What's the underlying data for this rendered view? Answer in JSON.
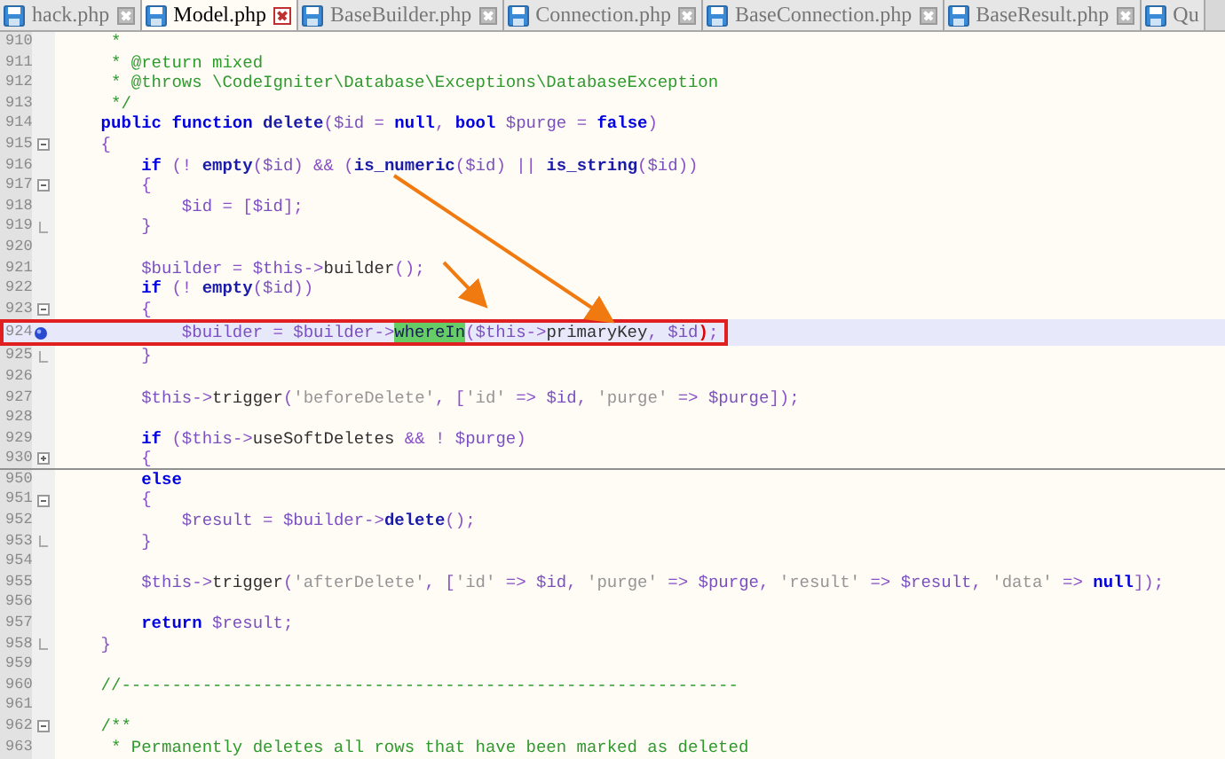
{
  "tabs": [
    {
      "label": "hack.php",
      "selected": false
    },
    {
      "label": "Model.php",
      "selected": true
    },
    {
      "label": "BaseBuilder.php",
      "selected": false
    },
    {
      "label": "Connection.php",
      "selected": false
    },
    {
      "label": "BaseConnection.php",
      "selected": false
    },
    {
      "label": "BaseResult.php",
      "selected": false
    },
    {
      "label": "Qu",
      "selected": false
    }
  ],
  "lines": [
    {
      "number": "910",
      "segments": [
        {
          "t": "     *",
          "kind": "cmt"
        }
      ]
    },
    {
      "number": "911",
      "segments": [
        {
          "t": "     * @return mixed",
          "kind": "cmt"
        }
      ]
    },
    {
      "number": "912",
      "segments": [
        {
          "t": "     * @throws \\CodeIgniter\\Database\\Exceptions\\DatabaseException",
          "kind": "cmt"
        }
      ]
    },
    {
      "number": "913",
      "segments": [
        {
          "t": "     */",
          "kind": "cmt"
        }
      ]
    },
    {
      "number": "914",
      "segments": [
        {
          "t": "    public function ",
          "kind": "kw"
        },
        {
          "t": "delete",
          "kind": "fn"
        },
        {
          "t": "(",
          "kind": "op"
        },
        {
          "t": "$id",
          "kind": "var"
        },
        {
          "t": " = ",
          "kind": "op"
        },
        {
          "t": "null",
          "kind": "kw"
        },
        {
          "t": ", ",
          "kind": "op"
        },
        {
          "t": "bool ",
          "kind": "kw"
        },
        {
          "t": "$purge",
          "kind": "var"
        },
        {
          "t": " = ",
          "kind": "op"
        },
        {
          "t": "false",
          "kind": "kw"
        },
        {
          "t": ")",
          "kind": "op"
        }
      ]
    },
    {
      "number": "915",
      "collapsible": true,
      "segments": [
        {
          "t": "    {",
          "kind": "op"
        }
      ]
    },
    {
      "number": "916",
      "segments": [
        {
          "t": "        if",
          "kind": "kw"
        },
        {
          "t": " (! ",
          "kind": "op"
        },
        {
          "t": "empty",
          "kind": "fn"
        },
        {
          "t": "(",
          "kind": "op"
        },
        {
          "t": "$id",
          "kind": "var"
        },
        {
          "t": ") && (",
          "kind": "op"
        },
        {
          "t": "is_numeric",
          "kind": "fn"
        },
        {
          "t": "(",
          "kind": "op"
        },
        {
          "t": "$id",
          "kind": "var"
        },
        {
          "t": ") || ",
          "kind": "op"
        },
        {
          "t": "is_string",
          "kind": "fn"
        },
        {
          "t": "(",
          "kind": "op"
        },
        {
          "t": "$id",
          "kind": "var"
        },
        {
          "t": "))",
          "kind": "op"
        }
      ]
    },
    {
      "number": "917",
      "collapsible": true,
      "segments": [
        {
          "t": "        {",
          "kind": "op"
        }
      ]
    },
    {
      "number": "918",
      "segments": [
        {
          "t": "            $id",
          "kind": "var"
        },
        {
          "t": " = [",
          "kind": "op"
        },
        {
          "t": "$id",
          "kind": "var"
        },
        {
          "t": "];",
          "kind": "op"
        }
      ]
    },
    {
      "number": "919",
      "block_end": true,
      "segments": [
        {
          "t": "        }",
          "kind": "op"
        }
      ]
    },
    {
      "number": "920"
    },
    {
      "number": "921",
      "segments": [
        {
          "t": "        $builder",
          "kind": "var"
        },
        {
          "t": " = ",
          "kind": "op"
        },
        {
          "t": "$this",
          "kind": "var"
        },
        {
          "t": "->",
          "kind": "op"
        },
        {
          "t": "builder",
          "kind": "plain"
        },
        {
          "t": "();",
          "kind": "op"
        }
      ]
    },
    {
      "number": "922",
      "segments": [
        {
          "t": "        if",
          "kind": "kw"
        },
        {
          "t": " (! ",
          "kind": "op"
        },
        {
          "t": "empty",
          "kind": "fn"
        },
        {
          "t": "(",
          "kind": "op"
        },
        {
          "t": "$id",
          "kind": "var"
        },
        {
          "t": "))",
          "kind": "op"
        }
      ]
    },
    {
      "number": "923",
      "collapsible": true,
      "segments": [
        {
          "t": "        {",
          "kind": "op"
        }
      ]
    },
    {
      "number": "924",
      "current": true,
      "breakpoint": true,
      "segments": [
        {
          "t": "            $builder",
          "kind": "var"
        },
        {
          "t": " = ",
          "kind": "op"
        },
        {
          "t": "$builder",
          "kind": "var"
        },
        {
          "t": "->",
          "kind": "op"
        },
        {
          "t": "whereIn",
          "kind": "match"
        },
        {
          "t": "(",
          "kind": "op"
        },
        {
          "t": "$this",
          "kind": "var"
        },
        {
          "t": "->",
          "kind": "op"
        },
        {
          "t": "primaryKey",
          "kind": "plain"
        },
        {
          "t": ", ",
          "kind": "op"
        },
        {
          "t": "$id",
          "kind": "var"
        },
        {
          "t": ")",
          "kind": "brace"
        },
        {
          "t": ";",
          "kind": "op"
        }
      ]
    },
    {
      "number": "925",
      "block_end": true,
      "segments": [
        {
          "t": "        }",
          "kind": "op"
        }
      ]
    },
    {
      "number": "926"
    },
    {
      "number": "927",
      "segments": [
        {
          "t": "        $this",
          "kind": "var"
        },
        {
          "t": "->",
          "kind": "op"
        },
        {
          "t": "trigger",
          "kind": "plain"
        },
        {
          "t": "(",
          "kind": "op"
        },
        {
          "t": "'beforeDelete'",
          "kind": "str"
        },
        {
          "t": ", [",
          "kind": "op"
        },
        {
          "t": "'id'",
          "kind": "str"
        },
        {
          "t": " => ",
          "kind": "op"
        },
        {
          "t": "$id",
          "kind": "var"
        },
        {
          "t": ", ",
          "kind": "op"
        },
        {
          "t": "'purge'",
          "kind": "str"
        },
        {
          "t": " => ",
          "kind": "op"
        },
        {
          "t": "$purge",
          "kind": "var"
        },
        {
          "t": "]);",
          "kind": "op"
        }
      ]
    },
    {
      "number": "928"
    },
    {
      "number": "929",
      "segments": [
        {
          "t": "        if",
          "kind": "kw"
        },
        {
          "t": " (",
          "kind": "op"
        },
        {
          "t": "$this",
          "kind": "var"
        },
        {
          "t": "->",
          "kind": "op"
        },
        {
          "t": "useSoftDeletes",
          "kind": "plain"
        },
        {
          "t": " && ! ",
          "kind": "op"
        },
        {
          "t": "$purge",
          "kind": "var"
        },
        {
          "t": ")",
          "kind": "op"
        }
      ]
    },
    {
      "number": "930",
      "collapsed": true,
      "segments": [
        {
          "t": "        {",
          "kind": "op"
        }
      ]
    },
    {
      "number": "950",
      "segments": [
        {
          "t": "        else",
          "kind": "kw"
        }
      ]
    },
    {
      "number": "951",
      "collapsible": true,
      "segments": [
        {
          "t": "        {",
          "kind": "op"
        }
      ]
    },
    {
      "number": "952",
      "segments": [
        {
          "t": "            $result",
          "kind": "var"
        },
        {
          "t": " = ",
          "kind": "op"
        },
        {
          "t": "$builder",
          "kind": "var"
        },
        {
          "t": "->",
          "kind": "op"
        },
        {
          "t": "delete",
          "kind": "fn"
        },
        {
          "t": "();",
          "kind": "op"
        }
      ]
    },
    {
      "number": "953",
      "block_end": true,
      "segments": [
        {
          "t": "        }",
          "kind": "op"
        }
      ]
    },
    {
      "number": "954"
    },
    {
      "number": "955",
      "segments": [
        {
          "t": "        $this",
          "kind": "var"
        },
        {
          "t": "->",
          "kind": "op"
        },
        {
          "t": "trigger",
          "kind": "plain"
        },
        {
          "t": "(",
          "kind": "op"
        },
        {
          "t": "'afterDelete'",
          "kind": "str"
        },
        {
          "t": ", [",
          "kind": "op"
        },
        {
          "t": "'id'",
          "kind": "str"
        },
        {
          "t": " => ",
          "kind": "op"
        },
        {
          "t": "$id",
          "kind": "var"
        },
        {
          "t": ", ",
          "kind": "op"
        },
        {
          "t": "'purge'",
          "kind": "str"
        },
        {
          "t": " => ",
          "kind": "op"
        },
        {
          "t": "$purge",
          "kind": "var"
        },
        {
          "t": ", ",
          "kind": "op"
        },
        {
          "t": "'result'",
          "kind": "str"
        },
        {
          "t": " => ",
          "kind": "op"
        },
        {
          "t": "$result",
          "kind": "var"
        },
        {
          "t": ", ",
          "kind": "op"
        },
        {
          "t": "'data'",
          "kind": "str"
        },
        {
          "t": " => ",
          "kind": "op"
        },
        {
          "t": "null",
          "kind": "kw"
        },
        {
          "t": "]);",
          "kind": "op"
        }
      ]
    },
    {
      "number": "956"
    },
    {
      "number": "957",
      "segments": [
        {
          "t": "        return ",
          "kind": "kw"
        },
        {
          "t": "$result",
          "kind": "var"
        },
        {
          "t": ";",
          "kind": "op"
        }
      ]
    },
    {
      "number": "958",
      "block_end": true,
      "segments": [
        {
          "t": "    }",
          "kind": "op"
        }
      ]
    },
    {
      "number": "959"
    },
    {
      "number": "960",
      "segments": [
        {
          "t": "    //-------------------------------------------------------------",
          "kind": "cmt"
        }
      ]
    },
    {
      "number": "961"
    },
    {
      "number": "962",
      "collapsible": true,
      "segments": [
        {
          "t": "    /**",
          "kind": "cmt"
        }
      ]
    },
    {
      "number": "963",
      "segments": [
        {
          "t": "     * Permanently deletes all rows that have been marked as deleted",
          "kind": "cmt"
        }
      ]
    }
  ]
}
